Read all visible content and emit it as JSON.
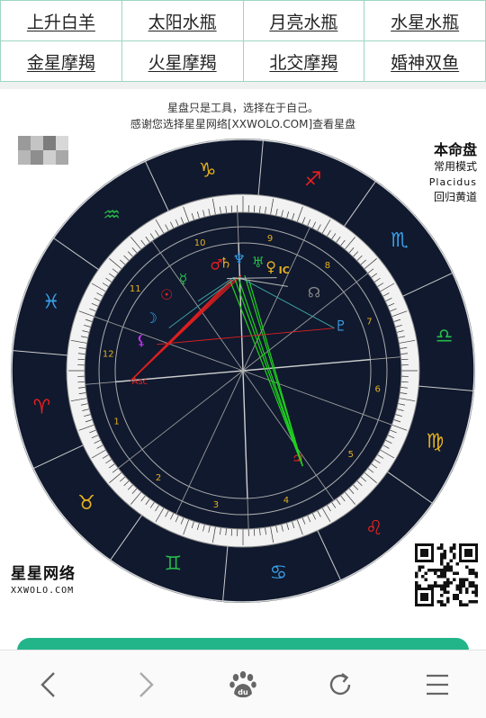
{
  "links": [
    {
      "label": "上升白羊"
    },
    {
      "label": "太阳水瓶"
    },
    {
      "label": "月亮水瓶"
    },
    {
      "label": "水星水瓶"
    },
    {
      "label": "金星摩羯"
    },
    {
      "label": "火星摩羯"
    },
    {
      "label": "北交摩羯"
    },
    {
      "label": "婚神双鱼"
    }
  ],
  "notice": {
    "line1": "星盘只是工具，选择在于自己。",
    "line2": "感谢您选择星星网络[XXWOLO.COM]查看星盘"
  },
  "chart_info": {
    "title": "本命盘",
    "mode": "常用模式",
    "house_system": "Placidus",
    "zodiac": "回归黄道"
  },
  "brand": {
    "name": "星星网络",
    "domain": "XXWOLO.COM"
  },
  "colors": {
    "wheel_background": "#10192e",
    "aspect_red": "#dd1f1f",
    "aspect_green": "#1fd31f",
    "aspect_teal": "#3fa0a0",
    "sign_green": "#26b84a",
    "sign_red": "#e8201e",
    "sign_yellow": "#e6b020",
    "sign_blue": "#3aa0e8",
    "action_bar": "#23b58a"
  },
  "wheel": {
    "signs": [
      {
        "symbol": "♈",
        "name": "aries",
        "color": "#e8201e"
      },
      {
        "symbol": "♉",
        "name": "taurus",
        "color": "#e6b020"
      },
      {
        "symbol": "♊",
        "name": "gemini",
        "color": "#26b84a"
      },
      {
        "symbol": "♋",
        "name": "cancer",
        "color": "#3aa0e8"
      },
      {
        "symbol": "♌",
        "name": "leo",
        "color": "#e8201e"
      },
      {
        "symbol": "♍",
        "name": "virgo",
        "color": "#e6b020"
      },
      {
        "symbol": "♎",
        "name": "libra",
        "color": "#26b84a"
      },
      {
        "symbol": "♏",
        "name": "scorpio",
        "color": "#3aa0e8"
      },
      {
        "symbol": "♐",
        "name": "sagittarius",
        "color": "#e8201e"
      },
      {
        "symbol": "♑",
        "name": "capricorn",
        "color": "#e6b020"
      },
      {
        "symbol": "♒",
        "name": "aquarius",
        "color": "#26b84a"
      },
      {
        "symbol": "♓",
        "name": "pisces",
        "color": "#3aa0e8"
      }
    ],
    "houses": [
      "1",
      "2",
      "3",
      "4",
      "5",
      "6",
      "7",
      "8",
      "9",
      "10",
      "11",
      "12"
    ],
    "asc_label": "Asc",
    "ic_label": "IC",
    "planets": [
      {
        "symbol": "♄",
        "name": "saturn",
        "color": "#e6b020"
      },
      {
        "symbol": "♂",
        "name": "mars",
        "color": "#e8201e"
      },
      {
        "symbol": "♆",
        "name": "neptune",
        "color": "#3aa0e8"
      },
      {
        "symbol": "♅",
        "name": "uranus",
        "color": "#26b84a"
      },
      {
        "symbol": "♀",
        "name": "venus",
        "color": "#e6b020"
      },
      {
        "symbol": "☿",
        "name": "mercury",
        "color": "#26b84a"
      },
      {
        "symbol": "☉",
        "name": "sun",
        "color": "#e8201e"
      },
      {
        "symbol": "☽",
        "name": "moon",
        "color": "#3aa0e8"
      },
      {
        "symbol": "⚸",
        "name": "lilith",
        "color": "#cc33ff"
      },
      {
        "symbol": "♃",
        "name": "jupiter",
        "color": "#e8201e"
      },
      {
        "symbol": "♇",
        "name": "pluto",
        "color": "#3aa0e8"
      },
      {
        "symbol": "☊",
        "name": "north-node",
        "color": "#888888"
      }
    ]
  },
  "browser_bar": {
    "buttons": [
      {
        "icon": "back-icon"
      },
      {
        "icon": "forward-icon"
      },
      {
        "icon": "baidu-paw-icon",
        "label": "du"
      },
      {
        "icon": "refresh-icon"
      },
      {
        "icon": "menu-icon"
      }
    ]
  }
}
